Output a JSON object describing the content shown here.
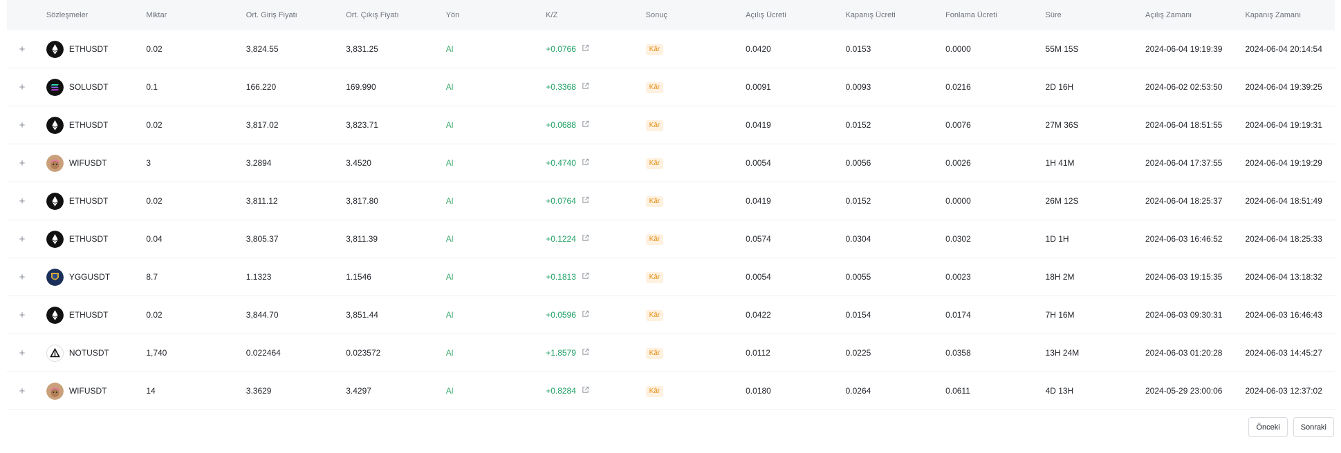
{
  "colors": {
    "accent_green": "#21a066",
    "badge_bg": "#fff1e0",
    "badge_text": "#e58e12"
  },
  "table": {
    "headers": [
      "Sözleşmeler",
      "Miktar",
      "Ort. Giriş Fiyatı",
      "Ort. Çıkış Fiyatı",
      "Yön",
      "K/Z",
      "Sonuç",
      "Açılış Ücreti",
      "Kapanış Ücreti",
      "Fonlama Ücreti",
      "Süre",
      "Açılış Zamanı",
      "Kapanış Zamanı"
    ],
    "rows": [
      {
        "coin_icon": "eth-icon",
        "contract": "ETHUSDT",
        "qty": "0.02",
        "entry": "3,824.55",
        "exit": "3,831.25",
        "side": "Al",
        "pnl": "+0.0766",
        "result": "Kâr",
        "open_fee": "0.0420",
        "close_fee": "0.0153",
        "funding_fee": "0.0000",
        "duration": "55M 15S",
        "open_time": "2024-06-04 19:19:39",
        "close_time": "2024-06-04 20:14:54"
      },
      {
        "coin_icon": "sol-icon",
        "contract": "SOLUSDT",
        "qty": "0.1",
        "entry": "166.220",
        "exit": "169.990",
        "side": "Al",
        "pnl": "+0.3368",
        "result": "Kâr",
        "open_fee": "0.0091",
        "close_fee": "0.0093",
        "funding_fee": "0.0216",
        "duration": "2D 16H",
        "open_time": "2024-06-02 02:53:50",
        "close_time": "2024-06-04 19:39:25"
      },
      {
        "coin_icon": "eth-icon",
        "contract": "ETHUSDT",
        "qty": "0.02",
        "entry": "3,817.02",
        "exit": "3,823.71",
        "side": "Al",
        "pnl": "+0.0688",
        "result": "Kâr",
        "open_fee": "0.0419",
        "close_fee": "0.0152",
        "funding_fee": "0.0076",
        "duration": "27M 36S",
        "open_time": "2024-06-04 18:51:55",
        "close_time": "2024-06-04 19:19:31"
      },
      {
        "coin_icon": "wif-icon",
        "contract": "WIFUSDT",
        "qty": "3",
        "entry": "3.2894",
        "exit": "3.4520",
        "side": "Al",
        "pnl": "+0.4740",
        "result": "Kâr",
        "open_fee": "0.0054",
        "close_fee": "0.0056",
        "funding_fee": "0.0026",
        "duration": "1H 41M",
        "open_time": "2024-06-04 17:37:55",
        "close_time": "2024-06-04 19:19:29"
      },
      {
        "coin_icon": "eth-icon",
        "contract": "ETHUSDT",
        "qty": "0.02",
        "entry": "3,811.12",
        "exit": "3,817.80",
        "side": "Al",
        "pnl": "+0.0764",
        "result": "Kâr",
        "open_fee": "0.0419",
        "close_fee": "0.0152",
        "funding_fee": "0.0000",
        "duration": "26M 12S",
        "open_time": "2024-06-04 18:25:37",
        "close_time": "2024-06-04 18:51:49"
      },
      {
        "coin_icon": "eth-icon",
        "contract": "ETHUSDT",
        "qty": "0.04",
        "entry": "3,805.37",
        "exit": "3,811.39",
        "side": "Al",
        "pnl": "+0.1224",
        "result": "Kâr",
        "open_fee": "0.0574",
        "close_fee": "0.0304",
        "funding_fee": "0.0302",
        "duration": "1D 1H",
        "open_time": "2024-06-03 16:46:52",
        "close_time": "2024-06-04 18:25:33"
      },
      {
        "coin_icon": "ygg-icon",
        "contract": "YGGUSDT",
        "qty": "8.7",
        "entry": "1.1323",
        "exit": "1.1546",
        "side": "Al",
        "pnl": "+0.1813",
        "result": "Kâr",
        "open_fee": "0.0054",
        "close_fee": "0.0055",
        "funding_fee": "0.0023",
        "duration": "18H 2M",
        "open_time": "2024-06-03 19:15:35",
        "close_time": "2024-06-04 13:18:32"
      },
      {
        "coin_icon": "eth-icon",
        "contract": "ETHUSDT",
        "qty": "0.02",
        "entry": "3,844.70",
        "exit": "3,851.44",
        "side": "Al",
        "pnl": "+0.0596",
        "result": "Kâr",
        "open_fee": "0.0422",
        "close_fee": "0.0154",
        "funding_fee": "0.0174",
        "duration": "7H 16M",
        "open_time": "2024-06-03 09:30:31",
        "close_time": "2024-06-03 16:46:43"
      },
      {
        "coin_icon": "not-icon",
        "contract": "NOTUSDT",
        "qty": "1,740",
        "entry": "0.022464",
        "exit": "0.023572",
        "side": "Al",
        "pnl": "+1.8579",
        "result": "Kâr",
        "open_fee": "0.0112",
        "close_fee": "0.0225",
        "funding_fee": "0.0358",
        "duration": "13H 24M",
        "open_time": "2024-06-03 01:20:28",
        "close_time": "2024-06-03 14:45:27"
      },
      {
        "coin_icon": "wif-icon",
        "contract": "WIFUSDT",
        "qty": "14",
        "entry": "3.3629",
        "exit": "3.4297",
        "side": "Al",
        "pnl": "+0.8284",
        "result": "Kâr",
        "open_fee": "0.0180",
        "close_fee": "0.0264",
        "funding_fee": "0.0611",
        "duration": "4D 13H",
        "open_time": "2024-05-29 23:00:06",
        "close_time": "2024-06-03 12:37:02"
      }
    ]
  },
  "pagination": {
    "prev_label": "Önceki",
    "next_label": "Sonraki"
  }
}
